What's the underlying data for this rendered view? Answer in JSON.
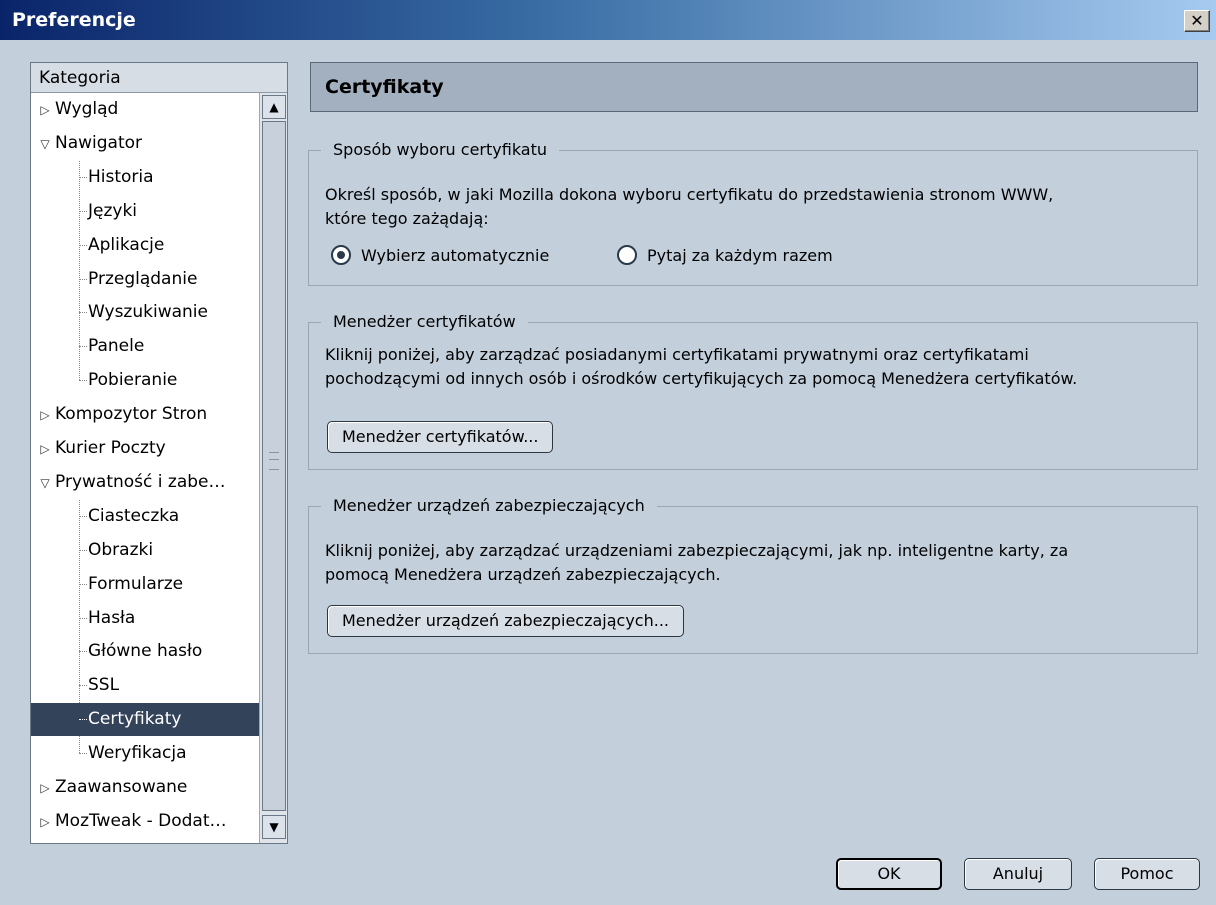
{
  "window": {
    "title": "Preferencje",
    "close_glyph": "✕"
  },
  "tree": {
    "header": "Kategoria",
    "items": [
      {
        "label": "Wygląd",
        "level": 0,
        "twisty": "closed",
        "selected": false
      },
      {
        "label": "Nawigator",
        "level": 0,
        "twisty": "open",
        "selected": false
      },
      {
        "label": "Historia",
        "level": 1,
        "selected": false
      },
      {
        "label": "Języki",
        "level": 1,
        "selected": false
      },
      {
        "label": "Aplikacje",
        "level": 1,
        "selected": false
      },
      {
        "label": "Przeglądanie",
        "level": 1,
        "selected": false
      },
      {
        "label": "Wyszukiwanie",
        "level": 1,
        "selected": false
      },
      {
        "label": "Panele",
        "level": 1,
        "selected": false
      },
      {
        "label": "Pobieranie",
        "level": 1,
        "selected": false
      },
      {
        "label": "Kompozytor Stron",
        "level": 0,
        "twisty": "closed",
        "selected": false
      },
      {
        "label": "Kurier Poczty",
        "level": 0,
        "twisty": "closed",
        "selected": false
      },
      {
        "label": "Prywatność i zabe…",
        "level": 0,
        "twisty": "open",
        "selected": false
      },
      {
        "label": "Ciasteczka",
        "level": 1,
        "selected": false
      },
      {
        "label": "Obrazki",
        "level": 1,
        "selected": false
      },
      {
        "label": "Formularze",
        "level": 1,
        "selected": false
      },
      {
        "label": "Hasła",
        "level": 1,
        "selected": false
      },
      {
        "label": "Główne hasło",
        "level": 1,
        "selected": false
      },
      {
        "label": "SSL",
        "level": 1,
        "selected": false
      },
      {
        "label": "Certyfikaty",
        "level": 1,
        "selected": true
      },
      {
        "label": "Weryfikacja",
        "level": 1,
        "selected": false
      },
      {
        "label": "Zaawansowane",
        "level": 0,
        "twisty": "closed",
        "selected": false
      },
      {
        "label": "MozTweak - Dodat…",
        "level": 0,
        "twisty": "closed",
        "selected": false
      }
    ]
  },
  "pane": {
    "title": "Certyfikaty",
    "groups": {
      "selection": {
        "legend": "Sposób wyboru certyfikatu",
        "line1": "Określ sposób, w jaki Mozilla dokona wyboru certyfikatu do przedstawienia stronom WWW,",
        "line2": "które tego zażądają:",
        "radio_auto": "Wybierz automatycznie",
        "radio_ask": "Pytaj za każdym razem",
        "selected": "auto"
      },
      "cert_manager": {
        "legend": "Menedżer certyfikatów",
        "line1": "Kliknij poniżej, aby zarządzać posiadanymi certyfikatami prywatnymi oraz certyfikatami",
        "line2": "pochodzącymi od innych osób i ośrodków certyfikujących za pomocą Menedżera certyfikatów.",
        "button": "Menedżer certyfikatów..."
      },
      "device_manager": {
        "legend": "Menedżer urządzeń zabezpieczających",
        "line1": "Kliknij poniżej, aby zarządzać urządzeniami zabezpieczającymi, jak np. inteligentne karty, za",
        "line2": "pomocą Menedżera urządzeń zabezpieczających.",
        "button": "Menedżer urządzeń zabezpieczających..."
      }
    }
  },
  "footer": {
    "ok": "OK",
    "cancel": "Anuluj",
    "help": "Pomoc"
  }
}
